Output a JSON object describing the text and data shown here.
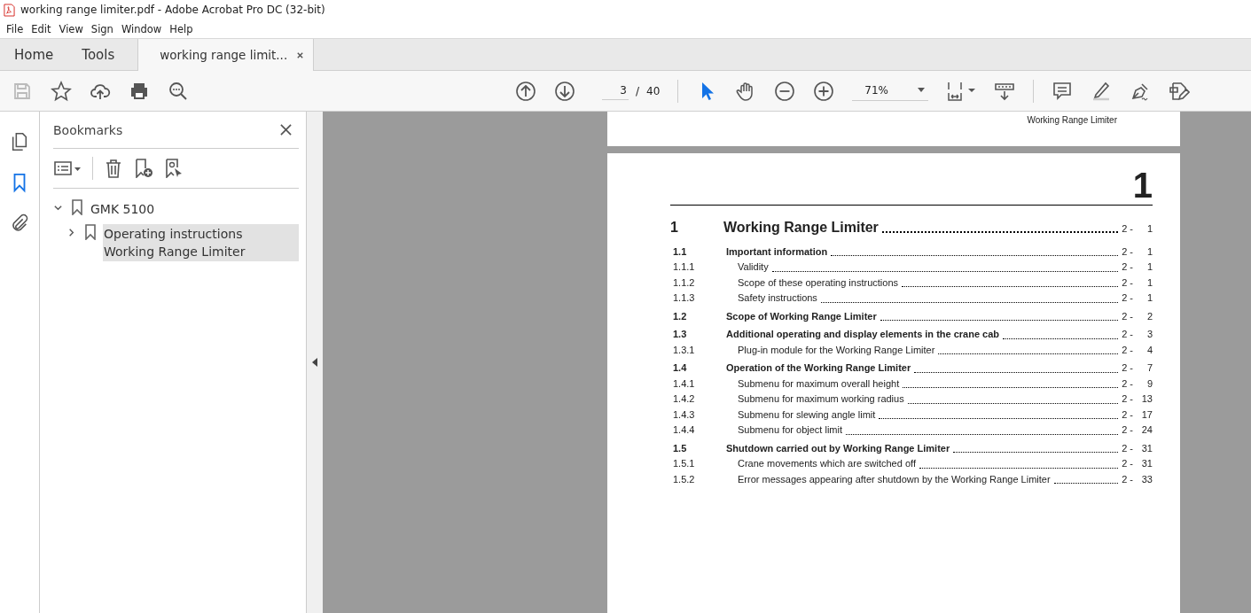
{
  "window": {
    "title": "working range limiter.pdf - Adobe Acrobat Pro DC (32-bit)"
  },
  "menu": [
    "File",
    "Edit",
    "View",
    "Sign",
    "Window",
    "Help"
  ],
  "tabs": [
    {
      "label": "Home",
      "selected": false,
      "closable": false
    },
    {
      "label": "Tools",
      "selected": false,
      "closable": false
    },
    {
      "label": "working range limit...",
      "selected": true,
      "closable": true
    }
  ],
  "toolbar": {
    "page": "3",
    "page_separator": "/",
    "page_count": "40",
    "zoom": "71%"
  },
  "sidebar": {
    "rail": [
      {
        "kind": "pages",
        "selected": false
      },
      {
        "kind": "bookmarks",
        "selected": true
      },
      {
        "kind": "attachments",
        "selected": false
      }
    ],
    "panel_title": "Bookmarks",
    "bookmarks": [
      {
        "label": "GMK 5100",
        "expanded": true,
        "selected": false,
        "children": [
          {
            "label": "Operating instructions Working Range Limiter",
            "expanded": false,
            "selected": true
          }
        ]
      }
    ]
  },
  "document": {
    "previous_page_header": "Working Range Limiter",
    "chapter_number": "1",
    "toc": [
      {
        "kind": "chapter",
        "number": "1",
        "title": "Working Range Limiter",
        "prefix": "2 -",
        "page": "1"
      },
      {
        "kind": "section",
        "number": "1.1",
        "title": "Important information",
        "prefix": "2 -",
        "page": "1"
      },
      {
        "kind": "subsection",
        "number": "1.1.1",
        "title": "Validity",
        "prefix": "2 -",
        "page": "1"
      },
      {
        "kind": "subsection",
        "number": "1.1.2",
        "title": "Scope of these operating instructions",
        "prefix": "2 -",
        "page": "1"
      },
      {
        "kind": "subsection",
        "number": "1.1.3",
        "title": "Safety instructions",
        "prefix": "2 -",
        "page": "1"
      },
      {
        "kind": "section",
        "number": "1.2",
        "title": "Scope of Working Range Limiter",
        "prefix": "2 -",
        "page": "2"
      },
      {
        "kind": "section",
        "number": "1.3",
        "title": "Additional operating and display elements in the crane cab",
        "prefix": "2 -",
        "page": "3"
      },
      {
        "kind": "subsection",
        "number": "1.3.1",
        "title": "Plug-in module for the Working Range Limiter",
        "prefix": "2 -",
        "page": "4"
      },
      {
        "kind": "section",
        "number": "1.4",
        "title": "Operation of the Working Range Limiter",
        "prefix": "2 -",
        "page": "7"
      },
      {
        "kind": "subsection",
        "number": "1.4.1",
        "title": "Submenu for maximum overall height",
        "prefix": "2 -",
        "page": "9"
      },
      {
        "kind": "subsection",
        "number": "1.4.2",
        "title": "Submenu for maximum working radius",
        "prefix": "2 -",
        "page": "13"
      },
      {
        "kind": "subsection",
        "number": "1.4.3",
        "title": "Submenu for slewing angle limit",
        "prefix": "2 -",
        "page": "17"
      },
      {
        "kind": "subsection",
        "number": "1.4.4",
        "title": "Submenu for object limit",
        "prefix": "2 -",
        "page": "24"
      },
      {
        "kind": "section",
        "number": "1.5",
        "title": "Shutdown carried out by Working Range Limiter",
        "prefix": "2 -",
        "page": "31"
      },
      {
        "kind": "subsection",
        "number": "1.5.1",
        "title": "Crane movements which are switched off",
        "prefix": "2 -",
        "page": "31"
      },
      {
        "kind": "subsection",
        "number": "1.5.2",
        "title": "Error messages appearing after shutdown by the Working Range Limiter",
        "prefix": "2 -",
        "page": "33"
      }
    ]
  }
}
